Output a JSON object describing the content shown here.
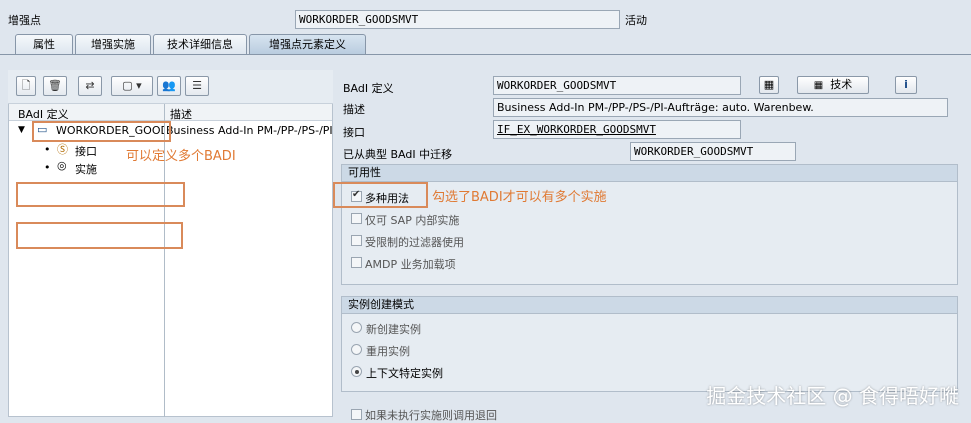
{
  "header": {
    "enhancement_point_label": "增强点",
    "enhancement_point_value": "WORKORDER_GOODSMVT",
    "status": "活动"
  },
  "tabs": [
    {
      "label": "属性"
    },
    {
      "label": "增强实施"
    },
    {
      "label": "技术详细信息"
    },
    {
      "label": "增强点元素定义"
    }
  ],
  "toolbar": {
    "buttons": [
      "new-doc-icon",
      "delete-icon",
      "move-icon",
      "dropdown-icon",
      "people-icon",
      "list-icon"
    ]
  },
  "tree": {
    "col_badi": "BAdI 定义",
    "col_desc": "描述",
    "root_name": "WORKORDER_GOODSMVT",
    "root_desc": "Business Add-In PM-/PP-/PS-/PI-Aufträge: auto. Warenbew.",
    "child_interface": "接口",
    "child_impl": "实施"
  },
  "annotations": {
    "define_many": "可以定义多个BADI",
    "checked_many": "勾选了BADI才可以有多个实施"
  },
  "detail": {
    "badi_def_label": "BAdI 定义",
    "badi_def_value": "WORKORDER_GOODSMVT",
    "tech_button": "技术",
    "desc_label": "描述",
    "desc_value": "Business Add-In PM-/PP-/PS-/PI-Aufträge: auto. Warenbew.",
    "interface_label": "接口",
    "interface_value": "IF_EX_WORKORDER_GOODSMVT",
    "migrated_label": "已从典型 BAdI 中迁移",
    "migrated_value": "WORKORDER_GOODSMVT"
  },
  "usability": {
    "title": "可用性",
    "options": [
      {
        "label": "多种用法",
        "checked": true
      },
      {
        "label": "仅可 SAP 内部实施",
        "checked": false
      },
      {
        "label": "受限制的过滤器使用",
        "checked": false
      },
      {
        "label": "AMDP 业务加载项",
        "checked": false
      }
    ]
  },
  "instance_mode": {
    "title": "实例创建模式",
    "options": [
      {
        "label": "新创建实例",
        "selected": false
      },
      {
        "label": "重用实例",
        "selected": false
      },
      {
        "label": "上下文特定实例",
        "selected": true
      }
    ]
  },
  "bottom_option": "如果未执行实施则调用退回",
  "watermark": "掘金技术社区 @ 食得唔好嘥"
}
